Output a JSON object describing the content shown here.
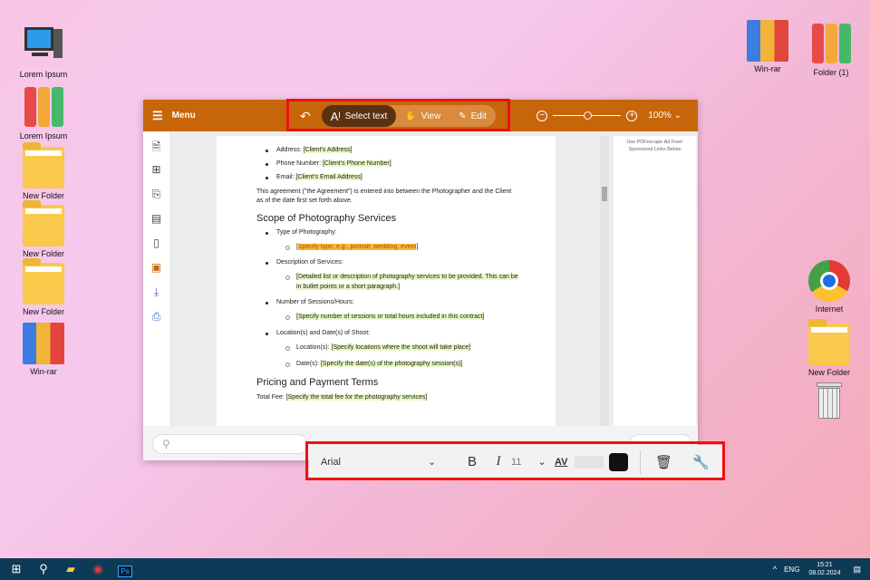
{
  "desktop": {
    "left_icons": [
      {
        "label": "Lorem Ipsum",
        "type": "computer"
      },
      {
        "label": "Lorem Ipsum",
        "type": "binders"
      },
      {
        "label": "New Folder",
        "type": "folder"
      },
      {
        "label": "New Folder",
        "type": "folder"
      },
      {
        "label": "New Folder",
        "type": "folder"
      },
      {
        "label": "Win-rar",
        "type": "rar"
      }
    ],
    "right_icons": [
      {
        "label": "Win-rar",
        "type": "rar"
      },
      {
        "label": "Folder (1)",
        "type": "binders"
      },
      {
        "label": "Internet",
        "type": "chrome"
      },
      {
        "label": "New Folder",
        "type": "folder"
      },
      {
        "label": "",
        "type": "trash"
      }
    ]
  },
  "app": {
    "menu_label": "Menu",
    "modes": {
      "select": "Select text",
      "view": "View",
      "edit": "Edit"
    },
    "zoom": "100%",
    "accent": "#c7650a",
    "ad": {
      "line1": "Use PDFescape Ad Free!",
      "line2": "Sponsored Links Below"
    }
  },
  "document": {
    "contact": [
      {
        "label": "Address: ",
        "value": "[Client's Address]"
      },
      {
        "label": "Phone Number: ",
        "value": "[Client's Phone Number]"
      },
      {
        "label": "Email: ",
        "value": "[Client's Email Address]"
      }
    ],
    "intro": "This agreement (\"the Agreement\") is entered into between the Photographer and the Client as of the date first set forth above.",
    "h_scope": "Scope of Photography Services",
    "type_label": "Type of Photography:",
    "type_value": "Specify type, e.g., portrait, wedding, event",
    "desc_label": "Description of Services:",
    "desc_value": "[Detailed list or description of photography services to be provided. This can be in bullet points or a short paragraph.]",
    "sessions_label": "Number of Sessions/Hours:",
    "sessions_value": "[Specify number of sessions or total hours included in this contract]",
    "loc_label": "Location(s) and Date(s) of Shoot:",
    "loc_sub": "Location(s): ",
    "loc_value": "[Specify locations where the shoot will take place]",
    "date_sub": "Date(s): ",
    "date_value": "[Specify the date(s) of the photography session(s)]",
    "h_pricing": "Pricing and Payment Terms",
    "fee_label": "Total Fee: ",
    "fee_value": "[Specify the total fee for the photography services]"
  },
  "format_toolbar": {
    "font": "Arial",
    "bold": "B",
    "italic": "I",
    "size": "11",
    "spacing": "AV",
    "color": "#111111"
  },
  "taskbar": {
    "lang": "ENG",
    "time": "15:21",
    "date": "08.02.2024"
  }
}
